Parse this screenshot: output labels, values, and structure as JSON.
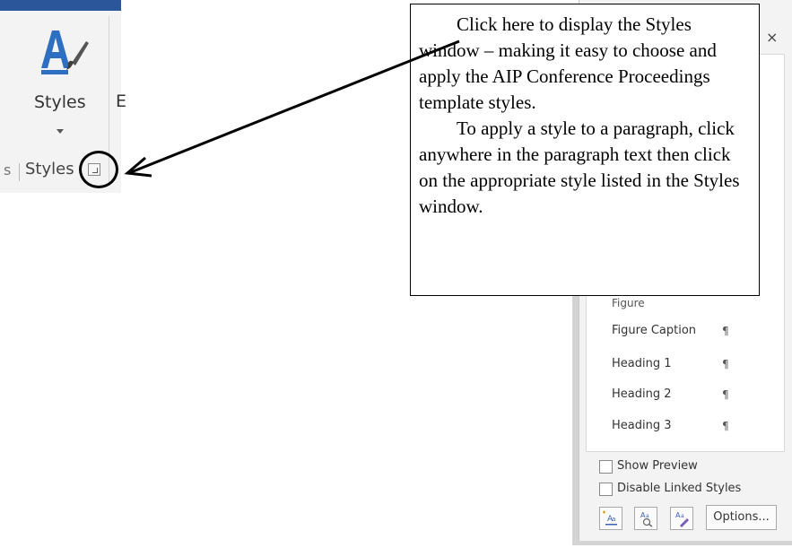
{
  "ribbon": {
    "styles_button_label": "Styles",
    "next_group_letter_fragment": "E",
    "left_group_fragment": "s",
    "group_label": "Styles",
    "dialog_launcher_icon": "dialog-launcher-icon",
    "styles_icon": "styles-paintbrush-icon",
    "accent_color": "#2b579a"
  },
  "callout": {
    "paragraph1": "Click here to display the Styles window – making it easy to choose and apply the AIP Conference Proceedings template styles.",
    "paragraph2": "To apply a style to a paragraph, click anywhere in the paragraph text then click on the appropriate style listed in the Styles window."
  },
  "styles_pane": {
    "close_icon": "×",
    "hidden_item_fragment": "Figure",
    "items": [
      {
        "label": "Figure Caption",
        "mark": "¶"
      },
      {
        "label": "Heading 1",
        "mark": "¶"
      },
      {
        "label": "Heading 2",
        "mark": "¶"
      },
      {
        "label": "Heading 3",
        "mark": "¶"
      }
    ],
    "show_preview_label": "Show Preview",
    "disable_linked_label": "Disable Linked Styles",
    "buttons": {
      "new_style_icon": "new-style-icon",
      "style_inspector_icon": "style-inspector-icon",
      "manage_styles_icon": "manage-styles-icon",
      "options_label": "Options..."
    }
  }
}
